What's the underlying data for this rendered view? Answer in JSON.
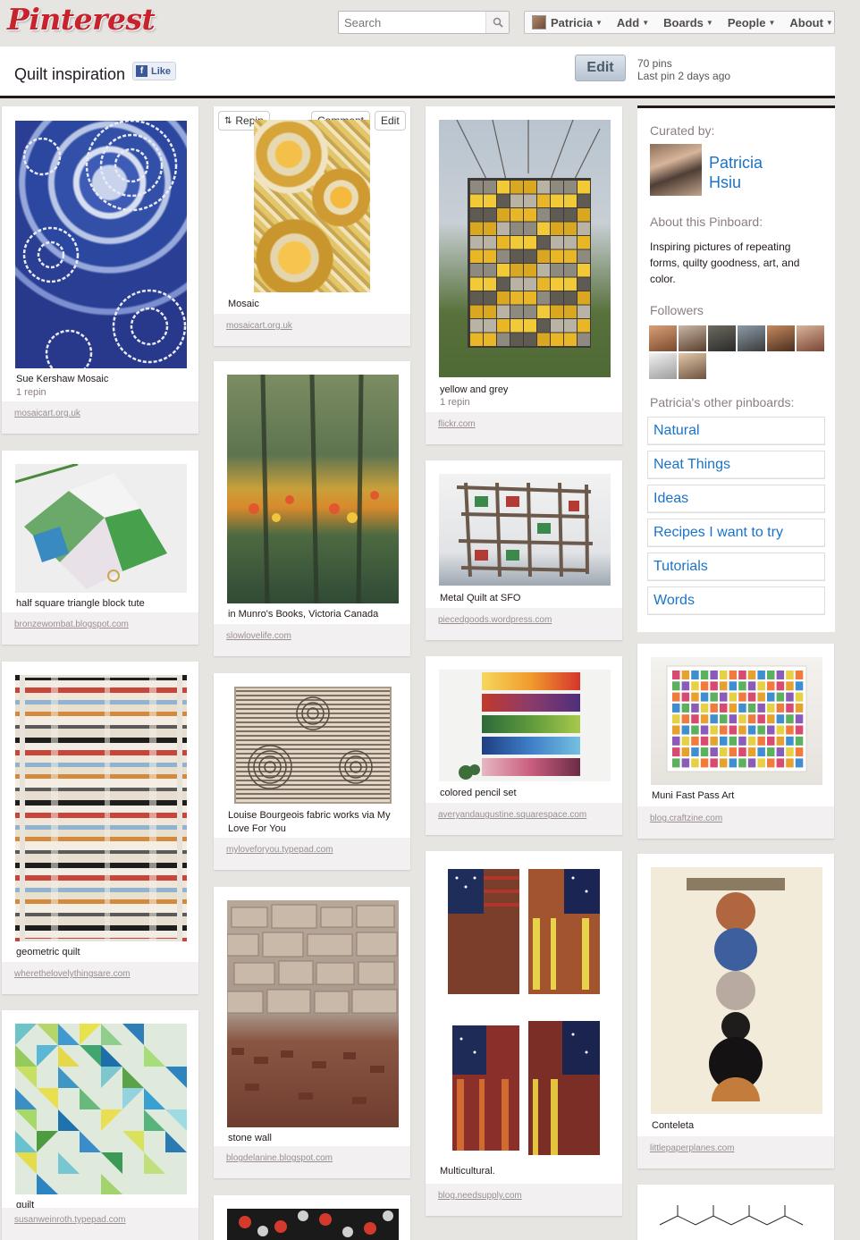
{
  "app": {
    "logo": "Pinterest"
  },
  "search": {
    "placeholder": "Search"
  },
  "nav": {
    "user": "Patricia",
    "add": "Add",
    "boards": "Boards",
    "people": "People",
    "about": "About"
  },
  "board": {
    "title": "Quilt inspiration",
    "like_label": "Like",
    "edit_label": "Edit",
    "pin_count": "70 pins",
    "last_pin": "Last pin 2 days ago"
  },
  "pin_actions": {
    "repin": "Repin",
    "comment": "Comment",
    "edit": "Edit"
  },
  "pins": [
    {
      "caption": "Sue Kershaw Mosaic",
      "repins": "1 repin",
      "source": "mosaicart.org.uk"
    },
    {
      "caption": "half square triangle block tute",
      "source": "bronzewombat.blogspot.com"
    },
    {
      "caption": "geometric quilt",
      "source": "wherethelovelythingsare.com"
    },
    {
      "caption": "quilt",
      "source": "susanweinroth.typepad.com"
    },
    {
      "caption": "Mosaic",
      "source": "mosaicart.org.uk"
    },
    {
      "caption": "in Munro's Books, Victoria Canada",
      "source": "slowlovelife.com"
    },
    {
      "caption": "Louise Bourgeois fabric works via My Love For You",
      "source": "myloveforyou.typepad.com"
    },
    {
      "caption": "stone wall",
      "source": "blogdelanine.blogspot.com"
    },
    {
      "caption": "yellow and grey",
      "repins": "1 repin",
      "source": "flickr.com"
    },
    {
      "caption": "Metal Quilt at SFO",
      "source": "piecedgoods.wordpress.com"
    },
    {
      "caption": "colored pencil set",
      "source": "averyandaugustine.squarespace.com"
    },
    {
      "caption": "Multicultural.",
      "source": "blog.needsupply.com"
    },
    {
      "caption": "Muni Fast Pass Art",
      "source": "blog.craftzine.com"
    },
    {
      "caption": "Conteleta",
      "source": "littlepaperplanes.com"
    }
  ],
  "sidebar": {
    "curated_by_label": "Curated by:",
    "curator_first": "Patricia",
    "curator_last": "Hsiu",
    "about_label": "About this Pinboard:",
    "about_text": "Inspiring pictures of repeating forms, quilty goodness, art, and color.",
    "followers_label": "Followers",
    "other_boards_label": "Patricia's other pinboards:",
    "other_boards": [
      "Natural",
      "Neat Things",
      "Ideas",
      "Recipes I want to try",
      "Tutorials",
      "Words"
    ]
  },
  "colors": {
    "brand_red": "#c8232c",
    "link_blue": "#1a73c8",
    "background": "#e7e5e2"
  }
}
